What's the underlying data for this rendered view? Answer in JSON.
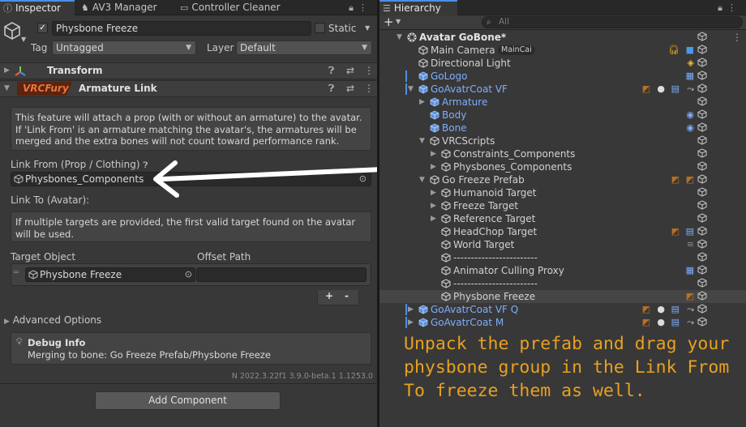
{
  "inspector": {
    "tabs": [
      {
        "label": "Inspector",
        "icon": "info-icon"
      },
      {
        "label": "AV3 Manager",
        "icon": "av3-icon"
      },
      {
        "label": "Controller Cleaner",
        "icon": "folder-icon"
      }
    ],
    "object_name": "Physbone Freeze",
    "static_label": "Static",
    "tag_label": "Tag",
    "tag_value": "Untagged",
    "layer_label": "Layer",
    "layer_value": "Default",
    "transform_title": "Transform",
    "vrcfury_badge": "VRCFury",
    "component_title": "Armature Link",
    "help_text": "This feature will attach a prop (with or without an armature) to the avatar. If 'Link From' is an armature matching the avatar's, the armatures will be merged and the extra bones will not count toward performance rank.",
    "link_from_label": "Link From (Prop / Clothing)",
    "link_from_value": "Physbones_Components",
    "link_to_label": "Link To (Avatar):",
    "link_to_help": "If multiple targets are provided, the first valid target found on the avatar will be used.",
    "target_object_label": "Target Object",
    "offset_path_label": "Offset Path",
    "target_object_value": "Physbone Freeze",
    "plus_label": "+",
    "minus_label": "-",
    "advanced_options": "Advanced Options",
    "debug_title": "Debug Info",
    "debug_text": "Merging to bone: Go Freeze Prefab/Physbone Freeze",
    "version_text": "N 2022.3.22f1 3.9.0-beta.1 1.1253.0",
    "add_component": "Add Component"
  },
  "hierarchy": {
    "tab_label": "Hierarchy",
    "search_placeholder": "All",
    "add_label": "+",
    "rows": [
      {
        "label": "Avatar GoBone*",
        "depth": 0,
        "fold": "open",
        "style": "root"
      },
      {
        "label": "Main Camera",
        "depth": 1,
        "fold": "none",
        "style": "normal",
        "tag": "MainCai"
      },
      {
        "label": "Directional Light",
        "depth": 1,
        "fold": "none",
        "style": "normal"
      },
      {
        "label": "GoLogo",
        "depth": 1,
        "fold": "none",
        "style": "blue"
      },
      {
        "label": "GoAvatrCoat VF",
        "depth": 1,
        "fold": "open",
        "style": "blue"
      },
      {
        "label": "Armature",
        "depth": 2,
        "fold": "closed",
        "style": "blue"
      },
      {
        "label": "Body",
        "depth": 2,
        "fold": "none",
        "style": "blue"
      },
      {
        "label": "Bone",
        "depth": 2,
        "fold": "none",
        "style": "blue"
      },
      {
        "label": "VRCScripts",
        "depth": 2,
        "fold": "open",
        "style": "normal"
      },
      {
        "label": "Constraints_Components",
        "depth": 3,
        "fold": "closed",
        "style": "normal"
      },
      {
        "label": "Physbones_Components",
        "depth": 3,
        "fold": "closed",
        "style": "normal"
      },
      {
        "label": "Go Freeze Prefab",
        "depth": 2,
        "fold": "open",
        "style": "normal"
      },
      {
        "label": "Humanoid Target",
        "depth": 3,
        "fold": "closed",
        "style": "normal"
      },
      {
        "label": "Freeze Target",
        "depth": 3,
        "fold": "closed",
        "style": "normal"
      },
      {
        "label": "Reference Target",
        "depth": 3,
        "fold": "closed",
        "style": "normal"
      },
      {
        "label": "HeadChop Target",
        "depth": 3,
        "fold": "none",
        "style": "normal"
      },
      {
        "label": "World Target",
        "depth": 3,
        "fold": "none",
        "style": "normal"
      },
      {
        "label": "------------------------",
        "depth": 3,
        "fold": "none",
        "style": "normal"
      },
      {
        "label": "Animator Culling Proxy",
        "depth": 3,
        "fold": "none",
        "style": "normal"
      },
      {
        "label": "------------------------",
        "depth": 3,
        "fold": "none",
        "style": "normal"
      },
      {
        "label": "Physbone Freeze",
        "depth": 3,
        "fold": "none",
        "style": "selected"
      },
      {
        "label": "GoAvatrCoat VF Q",
        "depth": 1,
        "fold": "closed",
        "style": "blue"
      },
      {
        "label": "GoAvatrCoat M",
        "depth": 1,
        "fold": "closed",
        "style": "blue"
      }
    ]
  },
  "annotation": "Unpack the prefab and drag your physbone group in the Link From To freeze them as well.",
  "colors": {
    "accent": "#4d8fe4",
    "annotation": "#e8a020",
    "vrcfury": "#c0531a",
    "prefab_blue": "#7eaefc"
  }
}
